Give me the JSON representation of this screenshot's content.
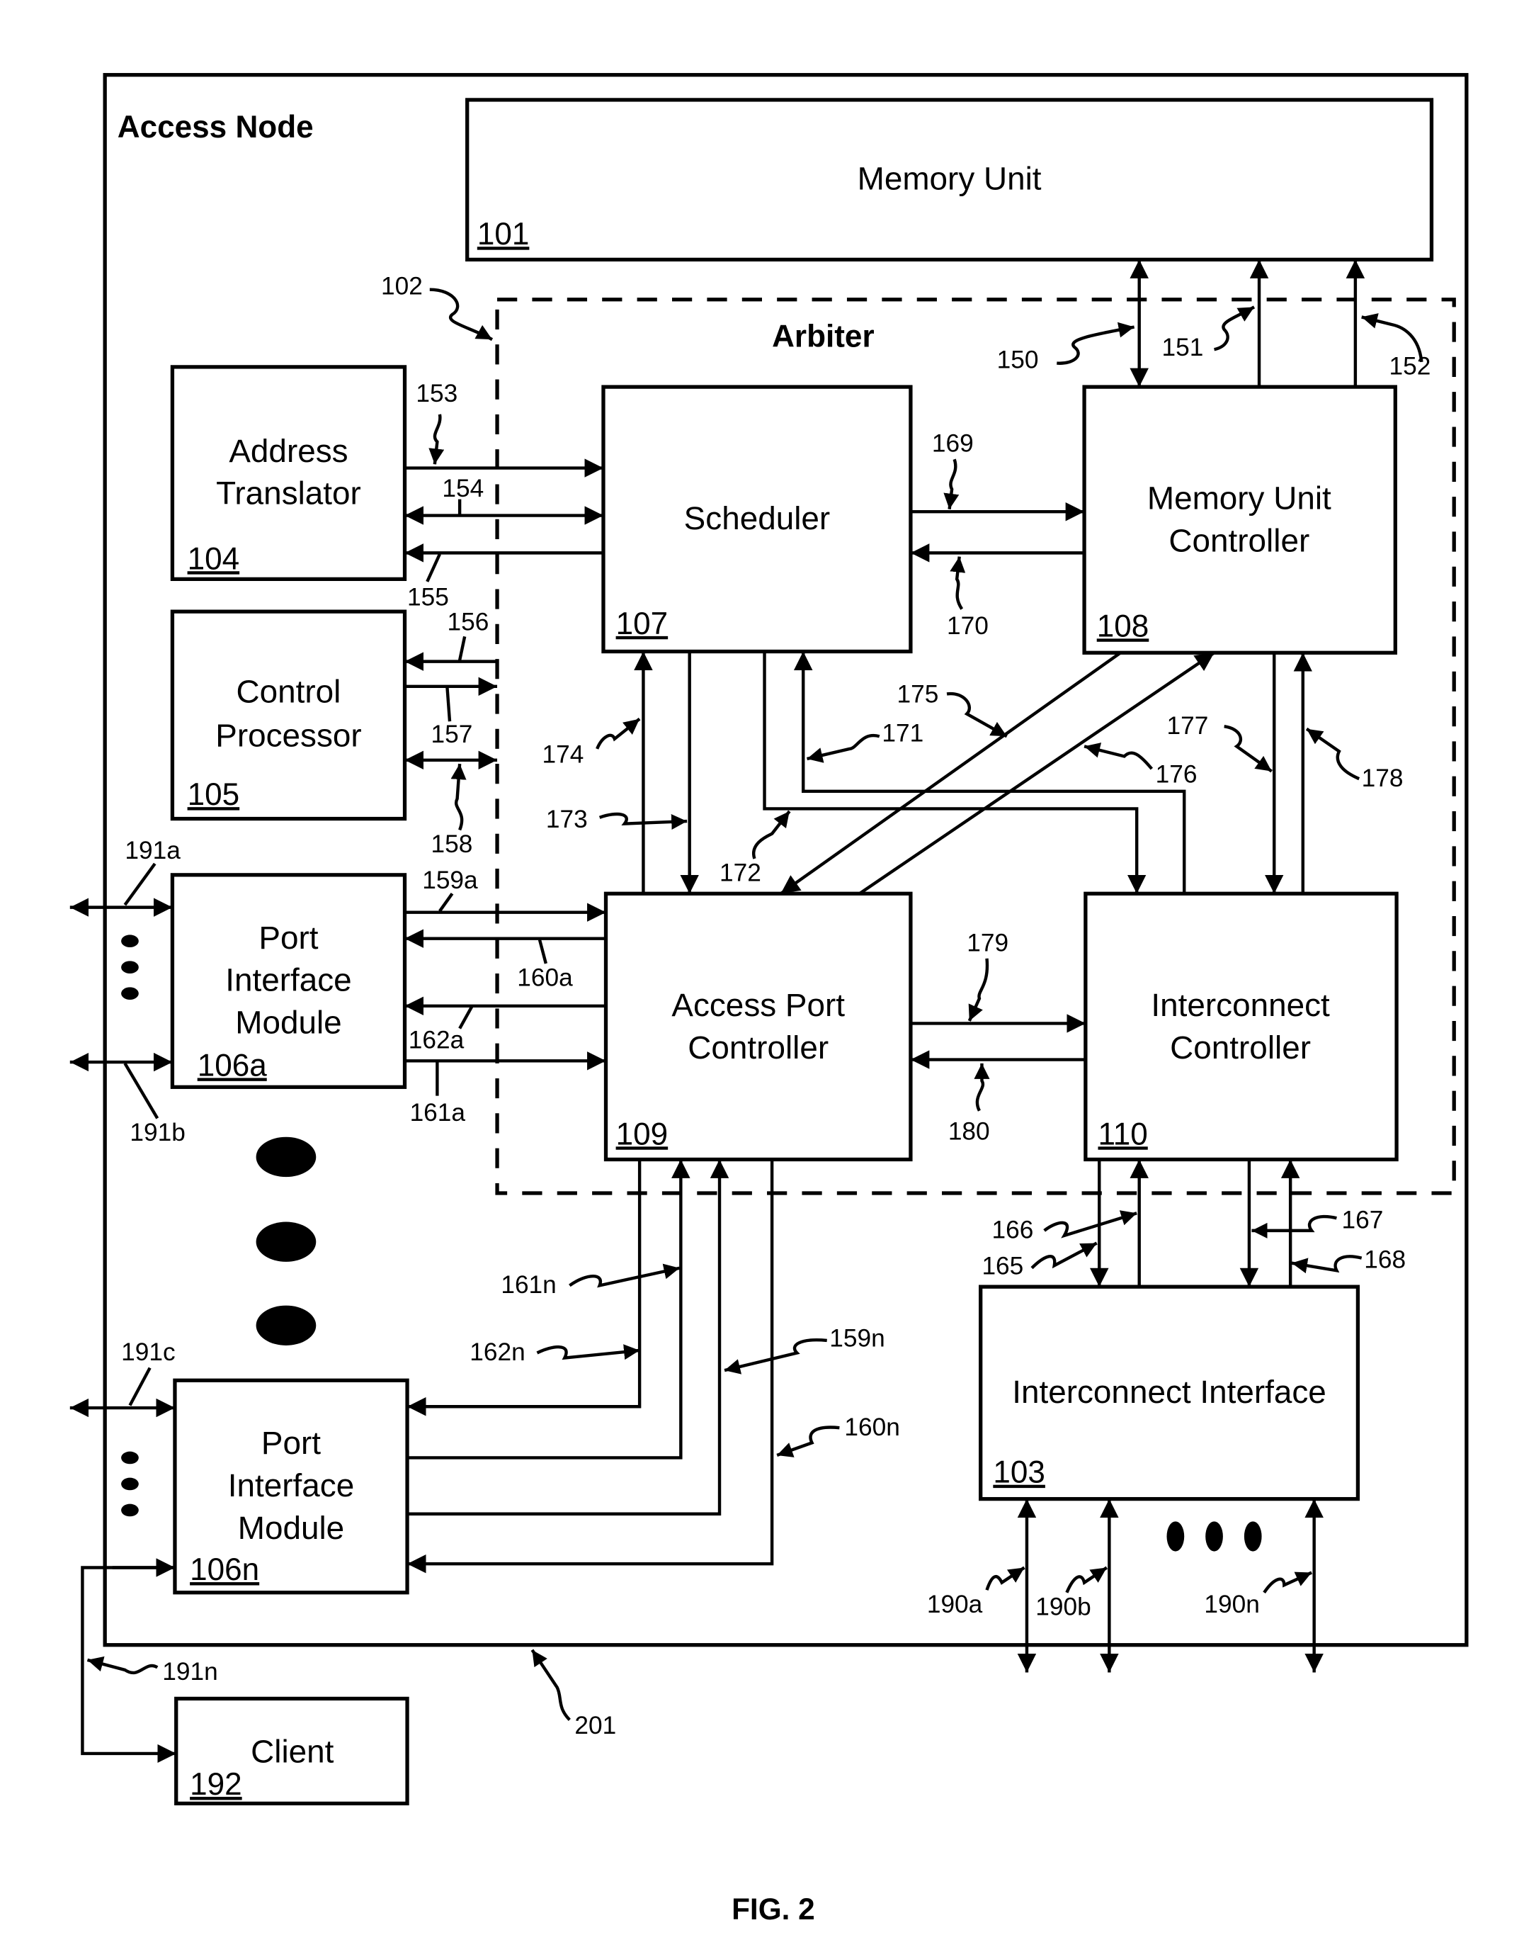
{
  "figure": {
    "caption": "FIG. 2",
    "container_title": "Access Node",
    "arbiter_title": "Arbiter",
    "arbiter_ref": "102",
    "container_ref": "201"
  },
  "blocks": {
    "memory_unit": {
      "name": "Memory Unit",
      "ref": "101"
    },
    "interconnect_interface": {
      "name": "Interconnect Interface",
      "ref": "103"
    },
    "address_translator": {
      "line1": "Address",
      "line2": "Translator",
      "ref": "104"
    },
    "control_processor": {
      "line1": "Control",
      "line2": "Processor",
      "ref": "105"
    },
    "port_interface_a": {
      "line1": "Port",
      "line2": "Interface",
      "line3": "Module",
      "ref": "106a"
    },
    "port_interface_n": {
      "line1": "Port",
      "line2": "Interface",
      "line3": "Module",
      "ref": "106n"
    },
    "scheduler": {
      "name": "Scheduler",
      "ref": "107"
    },
    "memory_unit_controller": {
      "line1": "Memory Unit",
      "line2": "Controller",
      "ref": "108"
    },
    "access_port_controller": {
      "line1": "Access Port",
      "line2": "Controller",
      "ref": "109"
    },
    "interconnect_controller": {
      "line1": "Interconnect",
      "line2": "Controller",
      "ref": "110"
    },
    "client": {
      "name": "Client",
      "ref": "192"
    }
  },
  "signal_labels": {
    "s150": "150",
    "s151": "151",
    "s152": "152",
    "s153": "153",
    "s154": "154",
    "s155": "155",
    "s156": "156",
    "s157": "157",
    "s158": "158",
    "s159a": "159a",
    "s160a": "160a",
    "s161a": "161a",
    "s162a": "162a",
    "s159n": "159n",
    "s160n": "160n",
    "s161n": "161n",
    "s162n": "162n",
    "s165": "165",
    "s166": "166",
    "s167": "167",
    "s168": "168",
    "s169": "169",
    "s170": "170",
    "s171": "171",
    "s172": "172",
    "s173": "173",
    "s174": "174",
    "s175": "175",
    "s176": "176",
    "s177": "177",
    "s178": "178",
    "s179": "179",
    "s180": "180",
    "s190a": "190a",
    "s190b": "190b",
    "s190n": "190n",
    "s191a": "191a",
    "s191b": "191b",
    "s191c": "191c",
    "s191n": "191n"
  }
}
